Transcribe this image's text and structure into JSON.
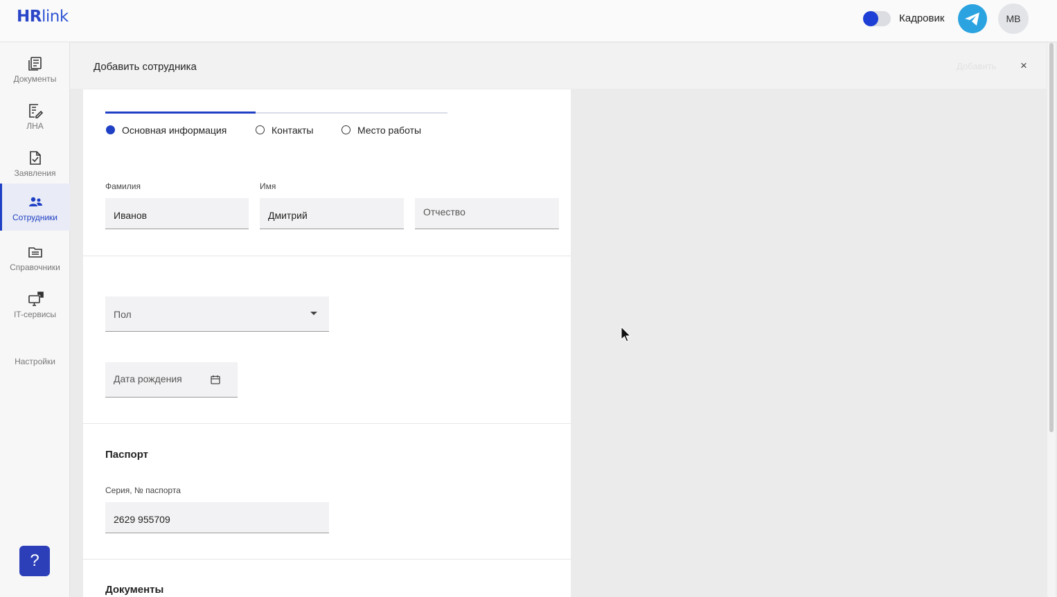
{
  "brand": {
    "logo_hr": "HR",
    "logo_link": "link"
  },
  "header": {
    "role_label": "Кадровик",
    "user_initials": "МВ"
  },
  "sidebar": {
    "items": [
      {
        "label": "Документы",
        "icon": "documents-icon"
      },
      {
        "label": "ЛНА",
        "icon": "lna-icon"
      },
      {
        "label": "Заявления",
        "icon": "applications-icon"
      },
      {
        "label": "Сотрудники",
        "icon": "employees-icon",
        "active": true
      },
      {
        "label": "Справочники",
        "icon": "directories-icon"
      },
      {
        "label": "IT-сервисы",
        "icon": "it-services-icon"
      },
      {
        "label": "Настройки",
        "icon": "settings-icon"
      }
    ],
    "help_label": "?"
  },
  "panel": {
    "title": "Добавить сотрудника",
    "ghost_text": "Добавить",
    "close_glyph": "×"
  },
  "steps": {
    "progress_fraction": 0.44,
    "items": [
      {
        "label": "Основная информация",
        "active": true
      },
      {
        "label": "Контакты",
        "active": false
      },
      {
        "label": "Место работы",
        "active": false
      }
    ]
  },
  "form": {
    "last_name": {
      "label": "Фамилия",
      "value": "Иванов"
    },
    "first_name": {
      "label": "Имя",
      "value": "Дмитрий"
    },
    "middle_name": {
      "placeholder": "Отчество"
    },
    "gender": {
      "placeholder": "Пол"
    },
    "birth_date": {
      "placeholder": "Дата рождения"
    },
    "passport": {
      "section_title": "Паспорт",
      "label": "Серия, № паспорта",
      "value": "2629 955709"
    },
    "documents": {
      "section_title": "Документы"
    }
  },
  "colors": {
    "accent": "#1f3fc4",
    "telegram": "#2aa3e0",
    "help": "#2c3fb9"
  }
}
